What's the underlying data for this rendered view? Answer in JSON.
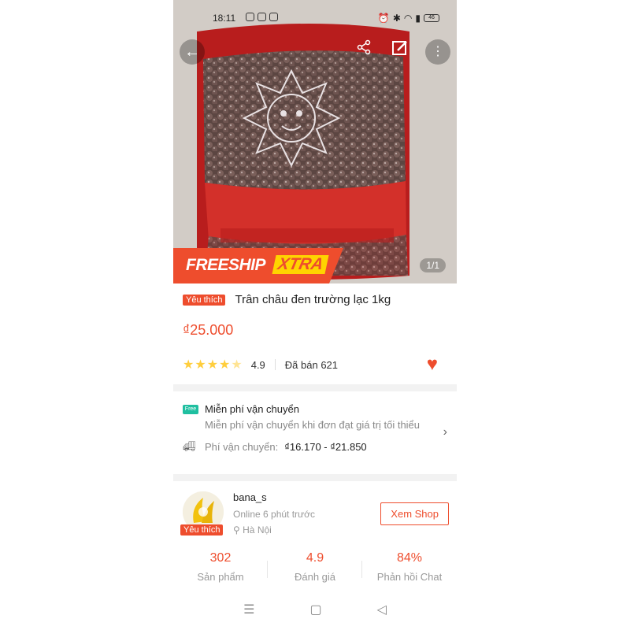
{
  "status_bar": {
    "time": "18:11",
    "battery": "46"
  },
  "image": {
    "counter": "1/1",
    "freeship_text": "FREESHIP",
    "freeship_xtra": "XTRA"
  },
  "product": {
    "badge": "Yêu thích",
    "title": "Trân châu đen trường lạc 1kg",
    "price": "₫25.000",
    "rating": "4.9",
    "sold": "Đã bán 621",
    "stars_filled": 4.5
  },
  "shipping": {
    "free_title": "Miễn phí vận chuyển",
    "free_desc": "Miễn phí vận chuyển khi đơn đạt giá trị tối thiểu",
    "fee_label": "Phí vận chuyển:",
    "fee_value": "₫16.170 - ₫21.850",
    "free_icon_text": "Free"
  },
  "shop": {
    "name": "bana_s",
    "online": "Online 6 phút trước",
    "location": "Hà Nội",
    "badge": "Yêu thích",
    "view_button": "Xem Shop",
    "stats": [
      {
        "value": "302",
        "label": "Sản phẩm"
      },
      {
        "value": "4.9",
        "label": "Đánh giá"
      },
      {
        "value": "84%",
        "label": "Phản hồi Chat"
      }
    ]
  },
  "colors": {
    "accent": "#ee4d2d",
    "star": "#ffce3d",
    "freeship_yellow": "#ffd400"
  }
}
